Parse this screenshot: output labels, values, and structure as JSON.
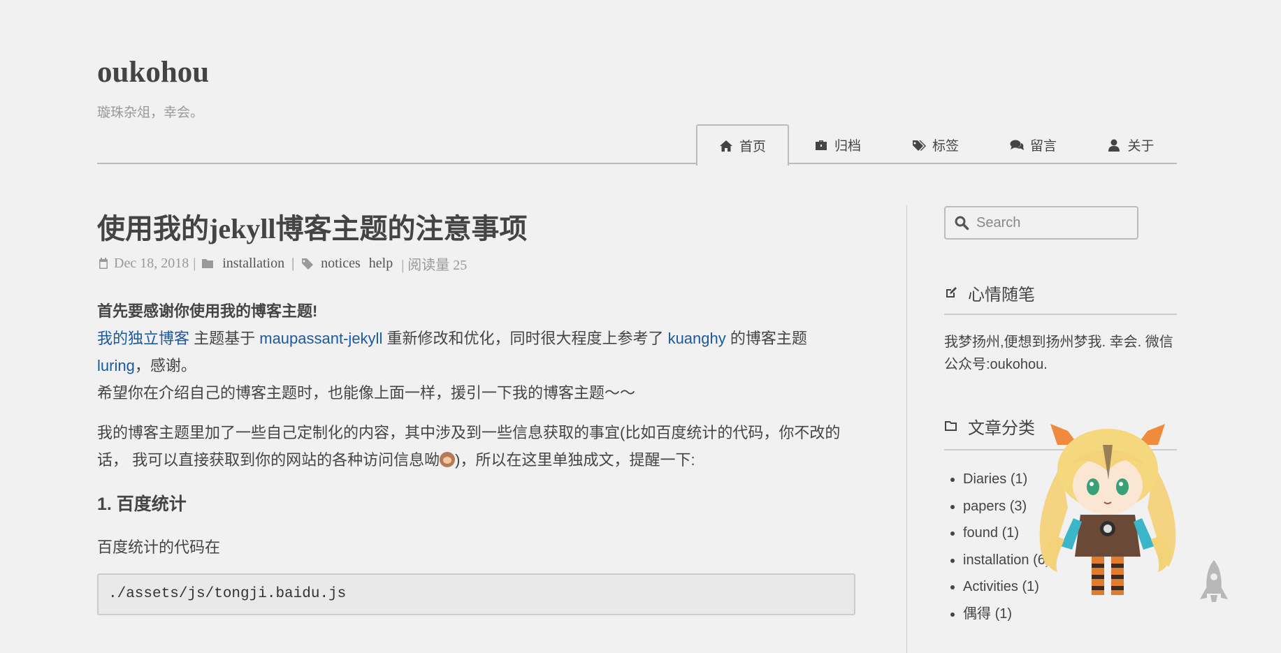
{
  "site": {
    "title": "oukohou",
    "description": "璇珠杂俎，幸会。"
  },
  "nav": {
    "items": [
      {
        "label": "首页",
        "icon": "home-icon",
        "active": true
      },
      {
        "label": "归档",
        "icon": "briefcase-icon"
      },
      {
        "label": "标签",
        "icon": "tags-icon"
      },
      {
        "label": "留言",
        "icon": "comments-icon"
      },
      {
        "label": "关于",
        "icon": "user-icon"
      }
    ]
  },
  "post": {
    "title": "使用我的jekyll博客主题的注意事项",
    "date": "Dec  18,  2018",
    "category": "installation",
    "tags": [
      "notices",
      "help"
    ],
    "views": "| 阅读量 25",
    "sep": "|",
    "p1_strong": "首先要感谢你使用我的博客主题!",
    "p2_link1": "我的独立博客",
    "p2_t1": " 主题基于 ",
    "p2_link2": "maupassant-jekyll",
    "p2_t2": " 重新修改和优化，同时很大程度上参考了 ",
    "p2_link3": "kuanghy",
    "p2_t3": " 的博客主题 ",
    "p2_link4": "luring",
    "p2_t4": "，感谢。",
    "p3": "希望你在介绍自己的博客主题时，也能像上面一样，援引一下我的博客主题～～",
    "p4_a": "我的博客主题里加了一些自己定制化的内容，其中涉及到一些信息获取的事宜(比如百度统计的代码，你不改的话， 我可以直接获取到你的网站的各种访问信息呦",
    "p4_b": ")，所以在这里单独成文，提醒一下:",
    "h2": "1. 百度统计",
    "p5": "百度统计的代码在",
    "code": "./assets/js/tongji.baidu.js"
  },
  "sidebar": {
    "search_placeholder": "Search",
    "mood_title": "心情随笔",
    "mood_text": "我梦扬州,便想到扬州梦我. 幸会. 微信公众号:oukohou.",
    "cat_title": "文章分类",
    "categories": [
      {
        "name": "Diaries",
        "count": "(1)"
      },
      {
        "name": "papers",
        "count": "(3)"
      },
      {
        "name": "found",
        "count": "(1)"
      },
      {
        "name": "installation",
        "count": "(6)"
      },
      {
        "name": "Activities",
        "count": "(1)"
      },
      {
        "name": "偶得",
        "count": "(1)"
      }
    ]
  },
  "icons": {
    "date": "calendar-icon",
    "category": "folder-icon",
    "tag": "tag-icon",
    "mood": "edit-icon",
    "cat": "folder-open-icon",
    "search": "search-icon",
    "mascot": "anime-mascot",
    "rocket": "rocket-icon"
  },
  "colors": {
    "background": "#f1f1f1",
    "text": "#444444",
    "link": "#1a5aa0",
    "muted": "#999999"
  }
}
